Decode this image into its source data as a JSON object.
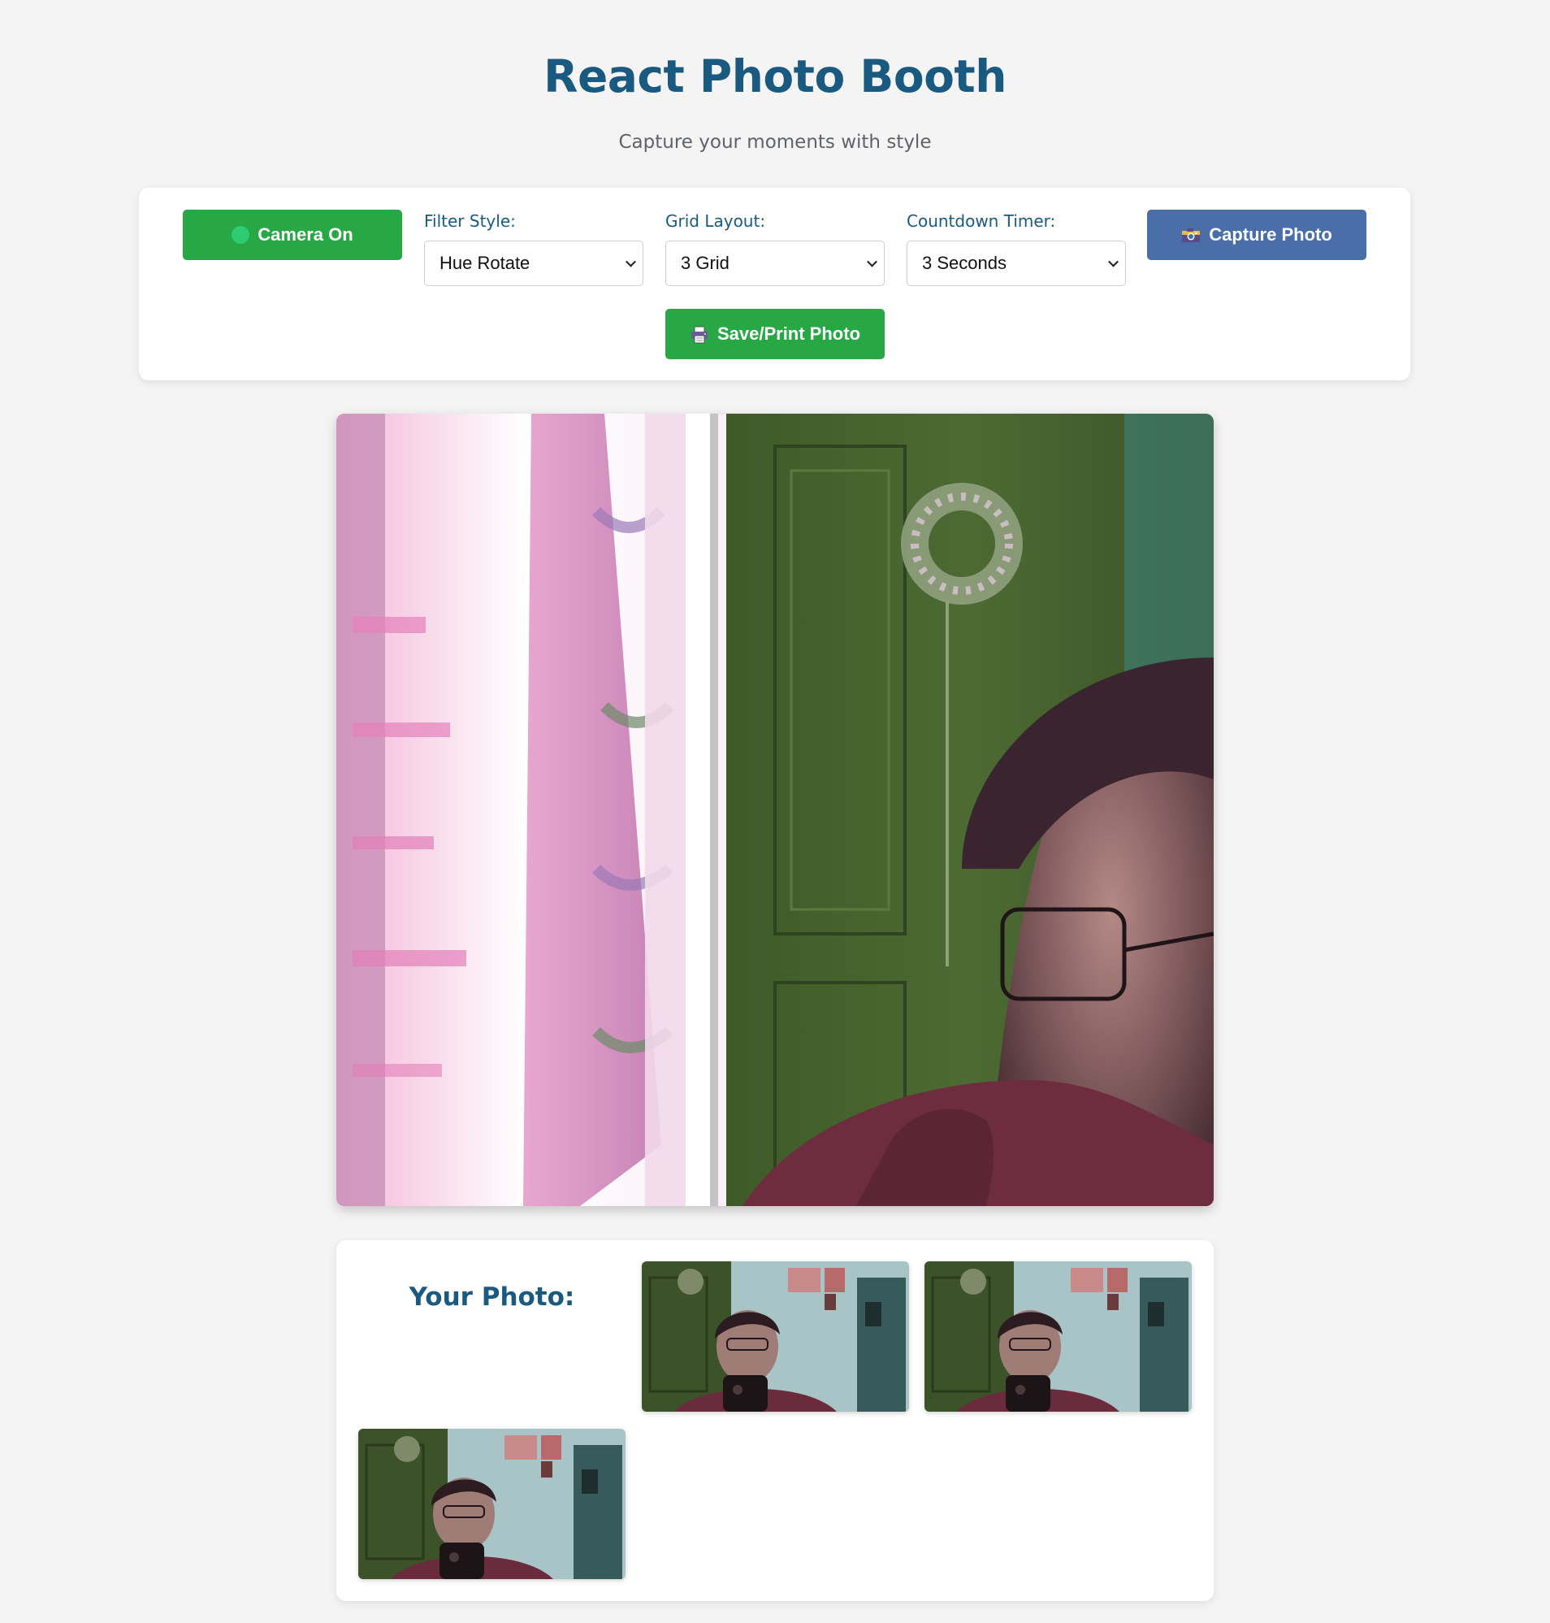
{
  "header": {
    "title": "React Photo Booth",
    "subtitle": "Capture your moments with style"
  },
  "controls": {
    "camera_button": {
      "label": "Camera On",
      "status": "on",
      "status_color": "#2ecc71",
      "icon": "status-dot-icon"
    },
    "filter": {
      "label": "Filter Style:",
      "selected": "Hue Rotate"
    },
    "grid": {
      "label": "Grid Layout:",
      "selected": "3 Grid"
    },
    "timer": {
      "label": "Countdown Timer:",
      "selected": "3 Seconds"
    },
    "capture_button": {
      "label": "Capture Photo",
      "icon": "camera-icon"
    },
    "save_button": {
      "label": "Save/Print Photo",
      "icon": "printer-icon"
    }
  },
  "photos": {
    "title": "Your Photo:",
    "count": 3
  },
  "colors": {
    "background": "#f4f4f4",
    "heading": "#1a5a80",
    "primary_green": "#28a745",
    "capture_blue": "#4a6ea8"
  }
}
